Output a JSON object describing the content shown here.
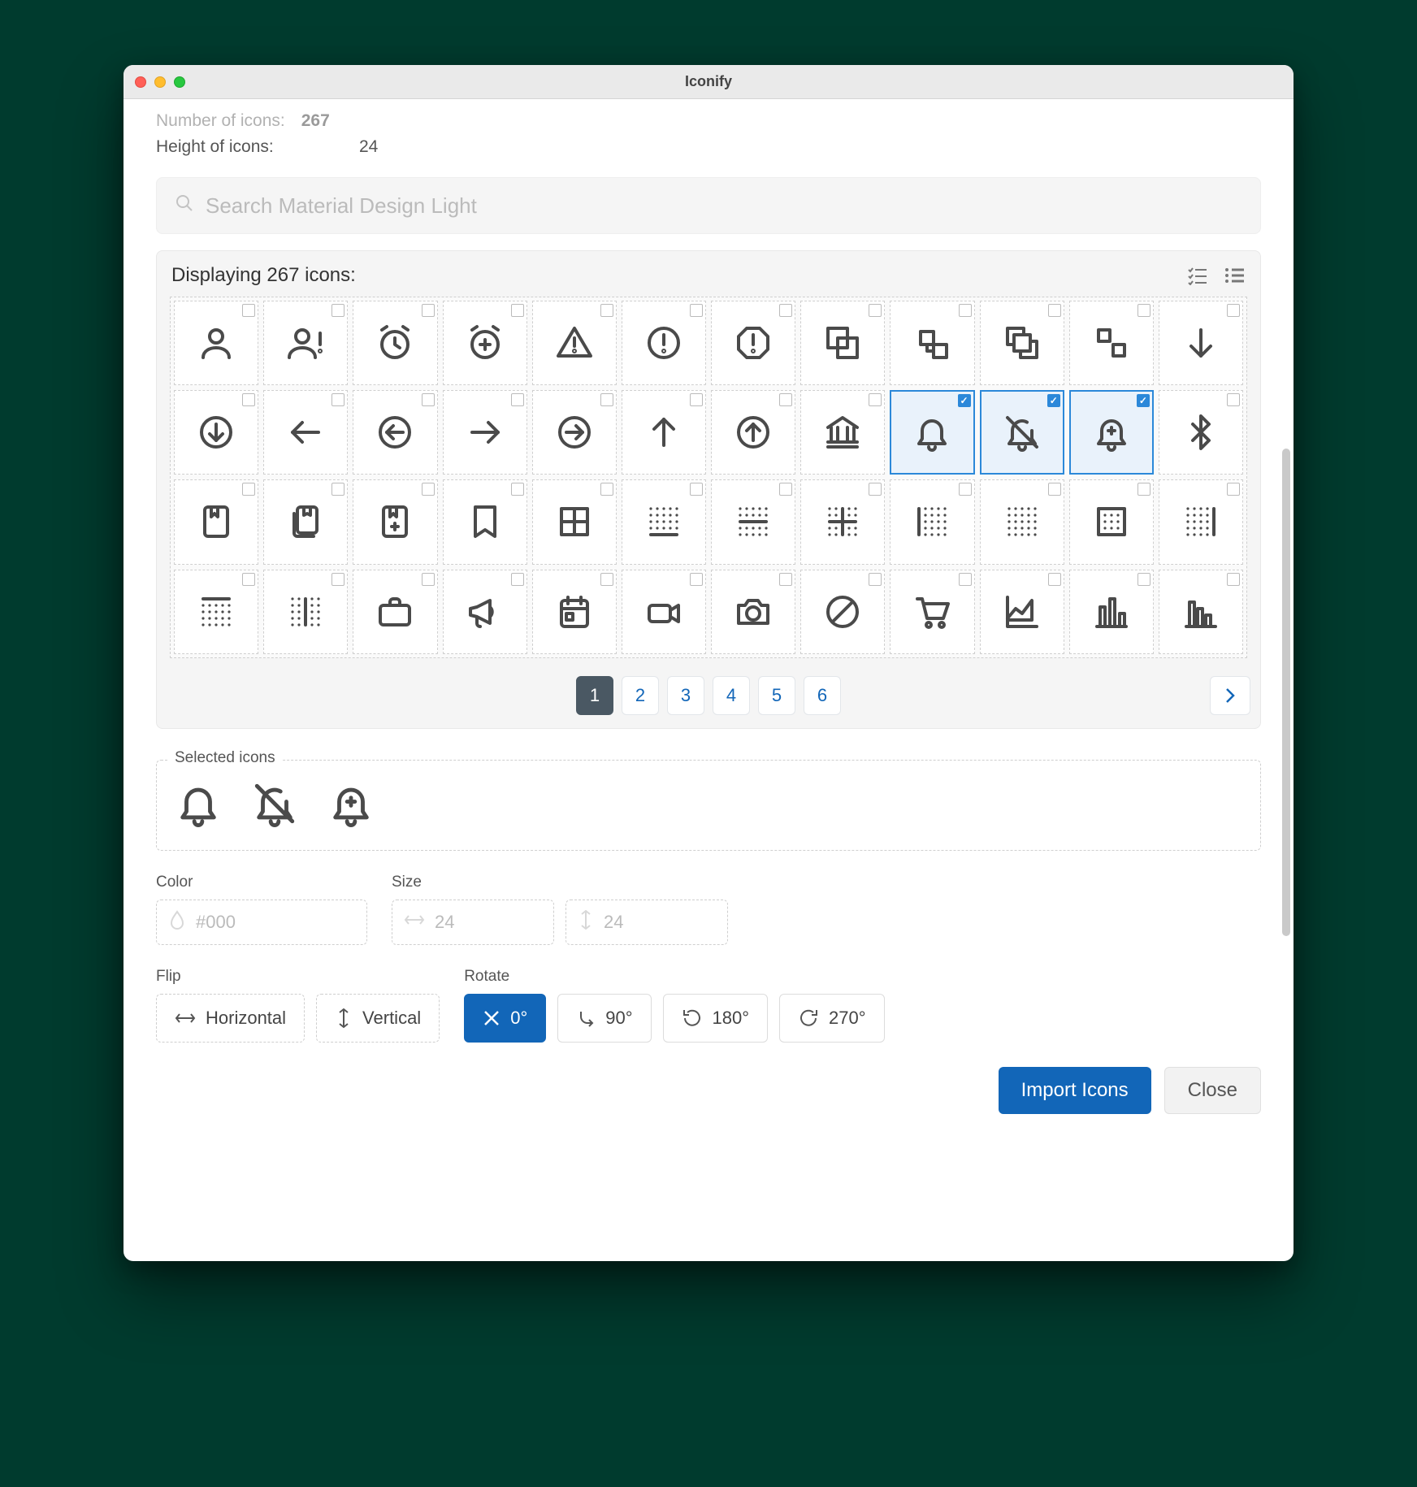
{
  "window": {
    "title": "Iconify"
  },
  "meta": {
    "number_label": "Number of icons:",
    "number_value": "267",
    "height_label": "Height of icons:",
    "height_value": "24"
  },
  "search": {
    "placeholder": "Search Material Design Light"
  },
  "grid_header": {
    "displaying_prefix": "Displaying ",
    "count": "267",
    "displaying_suffix": " icons:"
  },
  "icons": [
    {
      "name": "account",
      "selected": false
    },
    {
      "name": "account-alert",
      "selected": false
    },
    {
      "name": "alarm",
      "selected": false
    },
    {
      "name": "alarm-plus",
      "selected": false
    },
    {
      "name": "alert",
      "selected": false
    },
    {
      "name": "alert-circle",
      "selected": false
    },
    {
      "name": "alert-octagon",
      "selected": false
    },
    {
      "name": "arrange-bring-forward",
      "selected": false
    },
    {
      "name": "arrange-send-backward",
      "selected": false
    },
    {
      "name": "arrange-bring-to-front",
      "selected": false
    },
    {
      "name": "arrange-send-to-back",
      "selected": false
    },
    {
      "name": "arrow-down",
      "selected": false
    },
    {
      "name": "arrow-down-circle",
      "selected": false
    },
    {
      "name": "arrow-left",
      "selected": false
    },
    {
      "name": "arrow-left-circle",
      "selected": false
    },
    {
      "name": "arrow-right",
      "selected": false
    },
    {
      "name": "arrow-right-circle",
      "selected": false
    },
    {
      "name": "arrow-up",
      "selected": false
    },
    {
      "name": "arrow-up-circle",
      "selected": false
    },
    {
      "name": "bank",
      "selected": false
    },
    {
      "name": "bell",
      "selected": true
    },
    {
      "name": "bell-off",
      "selected": true
    },
    {
      "name": "bell-plus",
      "selected": true
    },
    {
      "name": "bluetooth",
      "selected": false
    },
    {
      "name": "book",
      "selected": false
    },
    {
      "name": "book-multiple",
      "selected": false
    },
    {
      "name": "book-plus",
      "selected": false
    },
    {
      "name": "bookmark",
      "selected": false
    },
    {
      "name": "border-all",
      "selected": false
    },
    {
      "name": "border-bottom",
      "selected": false
    },
    {
      "name": "border-horizontal",
      "selected": false
    },
    {
      "name": "border-inside",
      "selected": false
    },
    {
      "name": "border-left",
      "selected": false
    },
    {
      "name": "border-none",
      "selected": false
    },
    {
      "name": "border-outside",
      "selected": false
    },
    {
      "name": "border-right",
      "selected": false
    },
    {
      "name": "border-top",
      "selected": false
    },
    {
      "name": "border-vertical",
      "selected": false
    },
    {
      "name": "briefcase",
      "selected": false
    },
    {
      "name": "bullhorn",
      "selected": false
    },
    {
      "name": "calendar",
      "selected": false
    },
    {
      "name": "camcorder",
      "selected": false
    },
    {
      "name": "camera",
      "selected": false
    },
    {
      "name": "cancel",
      "selected": false
    },
    {
      "name": "cart",
      "selected": false
    },
    {
      "name": "chart-areaspline",
      "selected": false
    },
    {
      "name": "chart-bar",
      "selected": false
    },
    {
      "name": "chart-histogram",
      "selected": false
    }
  ],
  "pagination": {
    "pages": [
      "1",
      "2",
      "3",
      "4",
      "5",
      "6"
    ],
    "active": "1"
  },
  "selected_label": "Selected icons",
  "selected_icons": [
    "bell",
    "bell-off",
    "bell-plus"
  ],
  "color": {
    "label": "Color",
    "value": "",
    "placeholder": "#000"
  },
  "size": {
    "label": "Size",
    "w_placeholder": "24",
    "h_placeholder": "24"
  },
  "flip": {
    "label": "Flip",
    "h": "Horizontal",
    "v": "Vertical"
  },
  "rotate": {
    "label": "Rotate",
    "r0": "0°",
    "r90": "90°",
    "r180": "180°",
    "r270": "270°",
    "active": "0"
  },
  "buttons": {
    "import": "Import Icons",
    "close": "Close"
  }
}
